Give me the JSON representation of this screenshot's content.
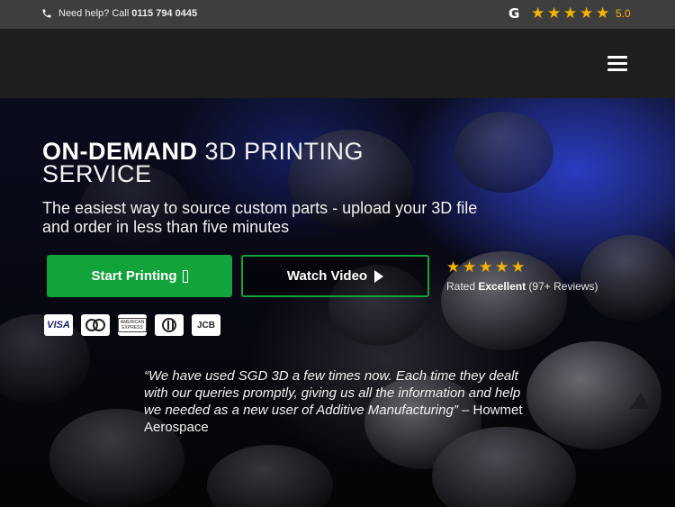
{
  "topbar": {
    "help_text": "Need help? Call",
    "phone_number": "0115 794 0445",
    "google_icon": "google-g-icon",
    "stars": [
      "★",
      "★",
      "★",
      "★",
      "★"
    ],
    "score": "5.0",
    "star_color": "#f5b301"
  },
  "navbar": {
    "menu_icon": "hamburger-menu-icon"
  },
  "hero": {
    "title_bold": "ON-DEMAND",
    "title_light": "3D PRINTING",
    "title_line2": "SERVICE",
    "subtitle": "The easiest way to source custom parts - upload your 3D file and order in less than five minutes",
    "start_button": "Start Printing",
    "watch_button": "Watch Video",
    "stars": [
      "★",
      "★",
      "★",
      "★",
      "★"
    ],
    "rated_prefix": "Rated",
    "rated_word": "Excellent",
    "rated_suffix": "(97+ Reviews)",
    "cards": {
      "visa": "VISA",
      "amex": "AMERICAN EXPRESS",
      "jcb": "JCB"
    },
    "quote": "“We have used SGD 3D a few times now. Each time they dealt with our queries promptly, giving us all the information and help we needed as a new user of Additive Manufacturing”",
    "quote_author": "– Howmet Aerospace",
    "accent_color": "#12a43a"
  }
}
